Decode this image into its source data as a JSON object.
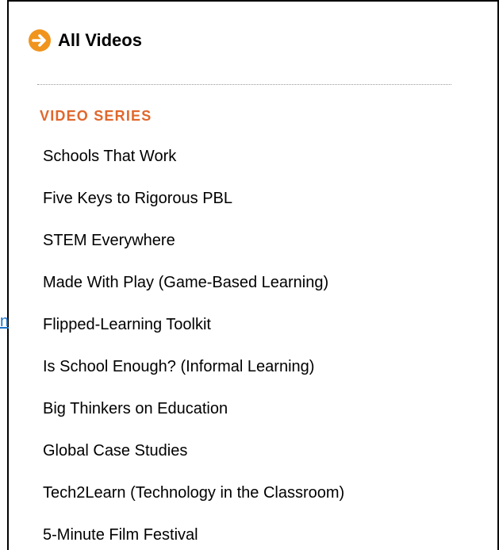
{
  "stray_link": {
    "text": "n"
  },
  "all_videos": {
    "label": "All Videos",
    "icon": "arrow-right-circle-icon",
    "icon_color": "#f0941e"
  },
  "video_series": {
    "heading": "VIDEO SERIES",
    "heading_color": "#e0672d",
    "items": [
      {
        "label": "Schools That Work"
      },
      {
        "label": "Five Keys to Rigorous PBL"
      },
      {
        "label": "STEM Everywhere"
      },
      {
        "label": "Made With Play (Game-Based Learning)"
      },
      {
        "label": "Flipped-Learning Toolkit"
      },
      {
        "label": "Is School Enough? (Informal Learning)"
      },
      {
        "label": "Big Thinkers on Education"
      },
      {
        "label": "Global Case Studies"
      },
      {
        "label": "Tech2Learn (Technology in the Classroom)"
      },
      {
        "label": "5-Minute Film Festival"
      }
    ]
  }
}
